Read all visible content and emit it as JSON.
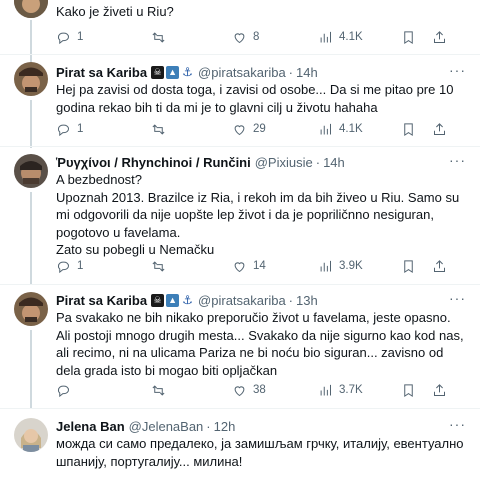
{
  "tweets": [
    {
      "text": "Kako je živeti u Riu?",
      "stats": {
        "replies": "1",
        "retweets": "",
        "likes": "8",
        "views": "4.1K"
      }
    },
    {
      "name": "Pirat sa Kariba",
      "badges": [
        "pirate-flag",
        "shark",
        "anchor"
      ],
      "handle": "@piratsakariba",
      "time": "14h",
      "text": "Hej pa zavisi od dosta toga, i zavisi od osobe... Da si me pitao pre 10 godina rekao bih ti da mi je to glavni cilj u životu hahaha",
      "stats": {
        "replies": "1",
        "retweets": "",
        "likes": "29",
        "views": "4.1K"
      }
    },
    {
      "name": "Ῥυγχίνοι / Rhynchinoi / Runčini",
      "handle": "@Pixiusie",
      "time": "14h",
      "text": "A bezbednost?\nUpoznah 2013. Brazilce iz Ria, i rekoh im da bih živeo u Riu. Samo su mi odgovorili da nije uopšte lep život i da je popriličnno nesiguran, pogotovo u favelama.\nZato su pobegli u Nemačku",
      "stats": {
        "replies": "1",
        "retweets": "",
        "likes": "14",
        "views": "3.9K"
      }
    },
    {
      "name": "Pirat sa Kariba",
      "badges": [
        "pirate-flag",
        "shark",
        "anchor"
      ],
      "handle": "@piratsakariba",
      "time": "13h",
      "text": "Pa svakako ne bih nikako preporučio život u favelama, jeste opasno. Ali postoji mnogo drugih mesta... Svakako da nije sigurno kao kod nas, ali recimo, ni na ulicama Pariza ne bi noću bio siguran... zavisno od dela grada isto bi mogao biti opljačkan",
      "stats": {
        "replies": "",
        "retweets": "",
        "likes": "38",
        "views": "3.7K"
      }
    },
    {
      "name": "Jelena Ban",
      "handle": "@JelenaBan",
      "time": "12h",
      "text": "можда си само предалеко, ја замишљам грчку, италију, евентуално шпанију, португалију... милина!"
    }
  ],
  "more_label": "···",
  "dot": "·",
  "colors": {
    "muted": "#536471",
    "text": "#0f1419",
    "divider": "#eff3f4",
    "thread": "#cfd9de"
  }
}
